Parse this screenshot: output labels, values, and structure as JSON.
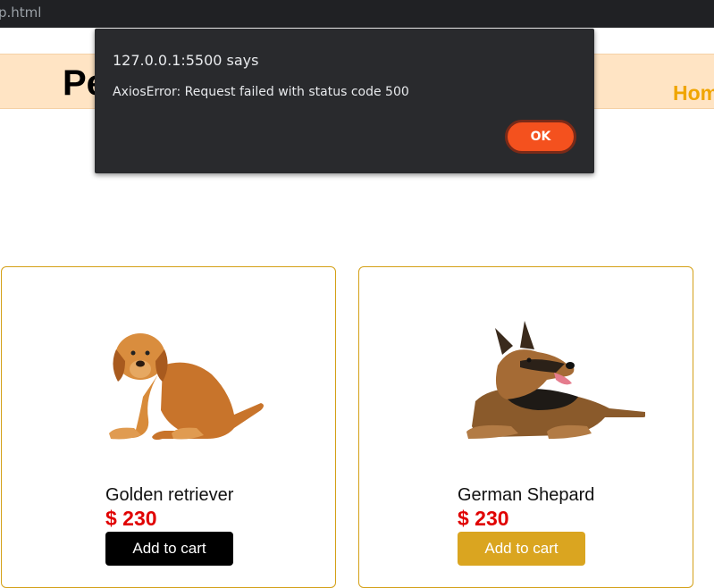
{
  "browser": {
    "url_fragment": "p.html"
  },
  "header": {
    "brand": "Pe",
    "nav_home": "Hom"
  },
  "products": [
    {
      "name": "Golden retriever",
      "price": "$ 230",
      "button": "Add to cart",
      "button_color": "#000000"
    },
    {
      "name": "German Shepard",
      "price": "$ 230",
      "button": "Add to cart",
      "button_color": "#daa520"
    }
  ],
  "dialog": {
    "title": "127.0.0.1:5500 says",
    "message": "AxiosError: Request failed with status code 500",
    "ok_label": "OK"
  },
  "colors": {
    "header_bg": "#ffe4c4",
    "card_border": "#d4a017",
    "price": "#e00000",
    "ok_button": "#f4511e",
    "dialog_bg": "#292a2d"
  },
  "icons": [
    "golden-retriever-image",
    "german-shepherd-image"
  ]
}
